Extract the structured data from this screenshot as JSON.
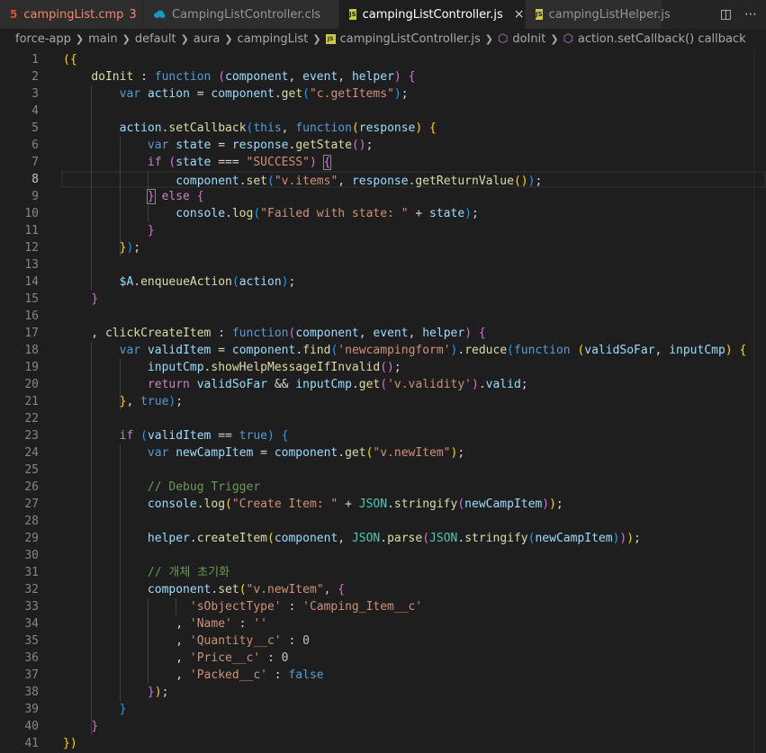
{
  "tabs": [
    {
      "label": "campingList.cmp",
      "badge": "3",
      "icon": "html-file-icon",
      "state": "error"
    },
    {
      "label": "CampingListController.cls",
      "icon": "salesforce-cloud-icon",
      "state": "normal"
    },
    {
      "label": "campingListController.js",
      "icon": "js-file-icon",
      "state": "active"
    },
    {
      "label": "campingListHelper.js",
      "icon": "js-file-icon",
      "state": "normal"
    }
  ],
  "tab_close_glyph": "×",
  "actions": {
    "split": "split-editor-icon",
    "more": "more-actions-icon"
  },
  "breadcrumb": [
    "force-app",
    "main",
    "default",
    "aura",
    "campingList",
    "campingListController.js",
    "doInit",
    "action.setCallback() callback"
  ],
  "colors": {
    "background": "#1e1e1e",
    "keyword": "#569cd6",
    "string": "#ce9178",
    "function": "#dcdcaa",
    "variable": "#9cdcfe",
    "comment": "#6a9955",
    "number": "#b5cea8",
    "control": "#c586c0"
  },
  "editor": {
    "current_line": 8,
    "lines": [
      [
        [
          "b1",
          "({"
        ]
      ],
      [
        [
          "pl",
          "    "
        ],
        [
          "fn",
          "doInit"
        ],
        [
          "pl",
          " : "
        ],
        [
          "kw",
          "function"
        ],
        [
          "pl",
          " "
        ],
        [
          "b2",
          "("
        ],
        [
          "vr",
          "component"
        ],
        [
          "pl",
          ", "
        ],
        [
          "vr",
          "event"
        ],
        [
          "pl",
          ", "
        ],
        [
          "vr",
          "helper"
        ],
        [
          "b2",
          ")"
        ],
        [
          "pl",
          " "
        ],
        [
          "b2",
          "{"
        ]
      ],
      [
        [
          "pl",
          "        "
        ],
        [
          "kw",
          "var"
        ],
        [
          "pl",
          " "
        ],
        [
          "vr",
          "action"
        ],
        [
          "pl",
          " = "
        ],
        [
          "vr",
          "component"
        ],
        [
          "pl",
          "."
        ],
        [
          "fn",
          "get"
        ],
        [
          "b3",
          "("
        ],
        [
          "st",
          "\"c.getItems\""
        ],
        [
          "b3",
          ")"
        ],
        [
          "pl",
          ";"
        ]
      ],
      [
        [
          "pl",
          ""
        ]
      ],
      [
        [
          "pl",
          "        "
        ],
        [
          "vr",
          "action"
        ],
        [
          "pl",
          "."
        ],
        [
          "fn",
          "setCallback"
        ],
        [
          "b3",
          "("
        ],
        [
          "kw",
          "this"
        ],
        [
          "pl",
          ", "
        ],
        [
          "kw",
          "function"
        ],
        [
          "b1",
          "("
        ],
        [
          "vr",
          "response"
        ],
        [
          "b1",
          ")"
        ],
        [
          "pl",
          " "
        ],
        [
          "b1",
          "{"
        ]
      ],
      [
        [
          "pl",
          "            "
        ],
        [
          "kw",
          "var"
        ],
        [
          "pl",
          " "
        ],
        [
          "vr",
          "state"
        ],
        [
          "pl",
          " = "
        ],
        [
          "vr",
          "response"
        ],
        [
          "pl",
          "."
        ],
        [
          "fn",
          "getState"
        ],
        [
          "b2",
          "()"
        ],
        [
          "pl",
          ";"
        ]
      ],
      [
        [
          "pl",
          "            "
        ],
        [
          "kc",
          "if"
        ],
        [
          "pl",
          " "
        ],
        [
          "b2",
          "("
        ],
        [
          "vr",
          "state"
        ],
        [
          "pl",
          " === "
        ],
        [
          "st",
          "\"SUCCESS\""
        ],
        [
          "b2",
          ")"
        ],
        [
          "pl",
          " "
        ],
        [
          "b2m",
          "{"
        ]
      ],
      [
        [
          "pl",
          "                "
        ],
        [
          "vr",
          "component"
        ],
        [
          "pl",
          "."
        ],
        [
          "fn",
          "set"
        ],
        [
          "b3",
          "("
        ],
        [
          "st",
          "\"v.items\""
        ],
        [
          "pl",
          ", "
        ],
        [
          "vr",
          "response"
        ],
        [
          "pl",
          "."
        ],
        [
          "fn",
          "getReturnValue"
        ],
        [
          "b1",
          "()"
        ],
        [
          "b3",
          ")"
        ],
        [
          "pl",
          ";"
        ]
      ],
      [
        [
          "pl",
          "            "
        ],
        [
          "b2m",
          "}"
        ],
        [
          "pl",
          " "
        ],
        [
          "kc",
          "else"
        ],
        [
          "pl",
          " "
        ],
        [
          "b2",
          "{"
        ]
      ],
      [
        [
          "pl",
          "                "
        ],
        [
          "vr",
          "console"
        ],
        [
          "pl",
          "."
        ],
        [
          "fn",
          "log"
        ],
        [
          "b3",
          "("
        ],
        [
          "st",
          "\"Failed with state: \""
        ],
        [
          "pl",
          " + "
        ],
        [
          "vr",
          "state"
        ],
        [
          "b3",
          ")"
        ],
        [
          "pl",
          ";"
        ]
      ],
      [
        [
          "pl",
          "            "
        ],
        [
          "b2",
          "}"
        ]
      ],
      [
        [
          "pl",
          "        "
        ],
        [
          "b1",
          "}"
        ],
        [
          "b3",
          ")"
        ],
        [
          "pl",
          ";"
        ]
      ],
      [
        [
          "pl",
          ""
        ]
      ],
      [
        [
          "pl",
          "        "
        ],
        [
          "vr",
          "$A"
        ],
        [
          "pl",
          "."
        ],
        [
          "fn",
          "enqueueAction"
        ],
        [
          "b3",
          "("
        ],
        [
          "vr",
          "action"
        ],
        [
          "b3",
          ")"
        ],
        [
          "pl",
          ";"
        ]
      ],
      [
        [
          "pl",
          "    "
        ],
        [
          "b2",
          "}"
        ]
      ],
      [
        [
          "pl",
          ""
        ]
      ],
      [
        [
          "pl",
          "    , "
        ],
        [
          "fn",
          "clickCreateItem"
        ],
        [
          "pl",
          " : "
        ],
        [
          "kw",
          "function"
        ],
        [
          "b2",
          "("
        ],
        [
          "vr",
          "component"
        ],
        [
          "pl",
          ", "
        ],
        [
          "vr",
          "event"
        ],
        [
          "pl",
          ", "
        ],
        [
          "vr",
          "helper"
        ],
        [
          "b2",
          ")"
        ],
        [
          "pl",
          " "
        ],
        [
          "b2",
          "{"
        ]
      ],
      [
        [
          "pl",
          "        "
        ],
        [
          "kw",
          "var"
        ],
        [
          "pl",
          " "
        ],
        [
          "vr",
          "validItem"
        ],
        [
          "pl",
          " = "
        ],
        [
          "vr",
          "component"
        ],
        [
          "pl",
          "."
        ],
        [
          "fn",
          "find"
        ],
        [
          "b3",
          "("
        ],
        [
          "st",
          "'newcampingform'"
        ],
        [
          "b3",
          ")"
        ],
        [
          "pl",
          "."
        ],
        [
          "fn",
          "reduce"
        ],
        [
          "b3",
          "("
        ],
        [
          "kw",
          "function"
        ],
        [
          "pl",
          " "
        ],
        [
          "b1",
          "("
        ],
        [
          "vr",
          "validSoFar"
        ],
        [
          "pl",
          ", "
        ],
        [
          "vr",
          "inputCmp"
        ],
        [
          "b1",
          ")"
        ],
        [
          "pl",
          " "
        ],
        [
          "b1",
          "{"
        ]
      ],
      [
        [
          "pl",
          "            "
        ],
        [
          "vr",
          "inputCmp"
        ],
        [
          "pl",
          "."
        ],
        [
          "fn",
          "showHelpMessageIfInvalid"
        ],
        [
          "b2",
          "()"
        ],
        [
          "pl",
          ";"
        ]
      ],
      [
        [
          "pl",
          "            "
        ],
        [
          "kc",
          "return"
        ],
        [
          "pl",
          " "
        ],
        [
          "vr",
          "validSoFar"
        ],
        [
          "pl",
          " && "
        ],
        [
          "vr",
          "inputCmp"
        ],
        [
          "pl",
          "."
        ],
        [
          "fn",
          "get"
        ],
        [
          "b2",
          "("
        ],
        [
          "st",
          "'v.validity'"
        ],
        [
          "b2",
          ")"
        ],
        [
          "pl",
          "."
        ],
        [
          "vr",
          "valid"
        ],
        [
          "pl",
          ";"
        ]
      ],
      [
        [
          "pl",
          "        "
        ],
        [
          "b1",
          "}"
        ],
        [
          "pl",
          ", "
        ],
        [
          "kw",
          "true"
        ],
        [
          "b3",
          ")"
        ],
        [
          "pl",
          ";"
        ]
      ],
      [
        [
          "pl",
          ""
        ]
      ],
      [
        [
          "pl",
          "        "
        ],
        [
          "kc",
          "if"
        ],
        [
          "pl",
          " "
        ],
        [
          "b3",
          "("
        ],
        [
          "vr",
          "validItem"
        ],
        [
          "pl",
          " == "
        ],
        [
          "kw",
          "true"
        ],
        [
          "b3",
          ")"
        ],
        [
          "pl",
          " "
        ],
        [
          "b3",
          "{"
        ]
      ],
      [
        [
          "pl",
          "            "
        ],
        [
          "kw",
          "var"
        ],
        [
          "pl",
          " "
        ],
        [
          "vr",
          "newCampItem"
        ],
        [
          "pl",
          " = "
        ],
        [
          "vr",
          "component"
        ],
        [
          "pl",
          "."
        ],
        [
          "fn",
          "get"
        ],
        [
          "b1",
          "("
        ],
        [
          "st",
          "\"v.newItem\""
        ],
        [
          "b1",
          ")"
        ],
        [
          "pl",
          ";"
        ]
      ],
      [
        [
          "pl",
          ""
        ]
      ],
      [
        [
          "pl",
          "            "
        ],
        [
          "cm",
          "// Debug Trigger"
        ]
      ],
      [
        [
          "pl",
          "            "
        ],
        [
          "vr",
          "console"
        ],
        [
          "pl",
          "."
        ],
        [
          "fn",
          "log"
        ],
        [
          "b1",
          "("
        ],
        [
          "st",
          "\"Create Item: \""
        ],
        [
          "pl",
          " + "
        ],
        [
          "ob",
          "JSON"
        ],
        [
          "pl",
          "."
        ],
        [
          "fn",
          "stringify"
        ],
        [
          "b2",
          "("
        ],
        [
          "vr",
          "newCampItem"
        ],
        [
          "b2",
          ")"
        ],
        [
          "b1",
          ")"
        ],
        [
          "pl",
          ";"
        ]
      ],
      [
        [
          "pl",
          ""
        ]
      ],
      [
        [
          "pl",
          "            "
        ],
        [
          "vr",
          "helper"
        ],
        [
          "pl",
          "."
        ],
        [
          "fn",
          "createItem"
        ],
        [
          "b1",
          "("
        ],
        [
          "vr",
          "component"
        ],
        [
          "pl",
          ", "
        ],
        [
          "ob",
          "JSON"
        ],
        [
          "pl",
          "."
        ],
        [
          "fn",
          "parse"
        ],
        [
          "b2",
          "("
        ],
        [
          "ob",
          "JSON"
        ],
        [
          "pl",
          "."
        ],
        [
          "fn",
          "stringify"
        ],
        [
          "b3",
          "("
        ],
        [
          "vr",
          "newCampItem"
        ],
        [
          "b3",
          ")"
        ],
        [
          "b2",
          ")"
        ],
        [
          "b1",
          ")"
        ],
        [
          "pl",
          ";"
        ]
      ],
      [
        [
          "pl",
          ""
        ]
      ],
      [
        [
          "pl",
          "            "
        ],
        [
          "cm",
          "// 개체 초기화"
        ]
      ],
      [
        [
          "pl",
          "            "
        ],
        [
          "vr",
          "component"
        ],
        [
          "pl",
          "."
        ],
        [
          "fn",
          "set"
        ],
        [
          "b1",
          "("
        ],
        [
          "st",
          "\"v.newItem\""
        ],
        [
          "pl",
          ", "
        ],
        [
          "b2",
          "{"
        ]
      ],
      [
        [
          "pl",
          "                  "
        ],
        [
          "st",
          "'sObjectType'"
        ],
        [
          "pl",
          " : "
        ],
        [
          "st",
          "'Camping_Item__c'"
        ]
      ],
      [
        [
          "pl",
          "                , "
        ],
        [
          "st",
          "'Name'"
        ],
        [
          "pl",
          " : "
        ],
        [
          "st",
          "''"
        ]
      ],
      [
        [
          "pl",
          "                , "
        ],
        [
          "st",
          "'Quantity__c'"
        ],
        [
          "pl",
          " : "
        ],
        [
          "nm",
          "0"
        ]
      ],
      [
        [
          "pl",
          "                , "
        ],
        [
          "st",
          "'Price__c'"
        ],
        [
          "pl",
          " : "
        ],
        [
          "nm",
          "0"
        ]
      ],
      [
        [
          "pl",
          "                , "
        ],
        [
          "st",
          "'Packed__c'"
        ],
        [
          "pl",
          " : "
        ],
        [
          "kw",
          "false"
        ]
      ],
      [
        [
          "pl",
          "            "
        ],
        [
          "b2",
          "}"
        ],
        [
          "b1",
          ")"
        ],
        [
          "pl",
          ";"
        ]
      ],
      [
        [
          "pl",
          "        "
        ],
        [
          "b3",
          "}"
        ]
      ],
      [
        [
          "pl",
          "    "
        ],
        [
          "b2",
          "}"
        ]
      ],
      [
        [
          "b1",
          "})"
        ]
      ]
    ]
  }
}
